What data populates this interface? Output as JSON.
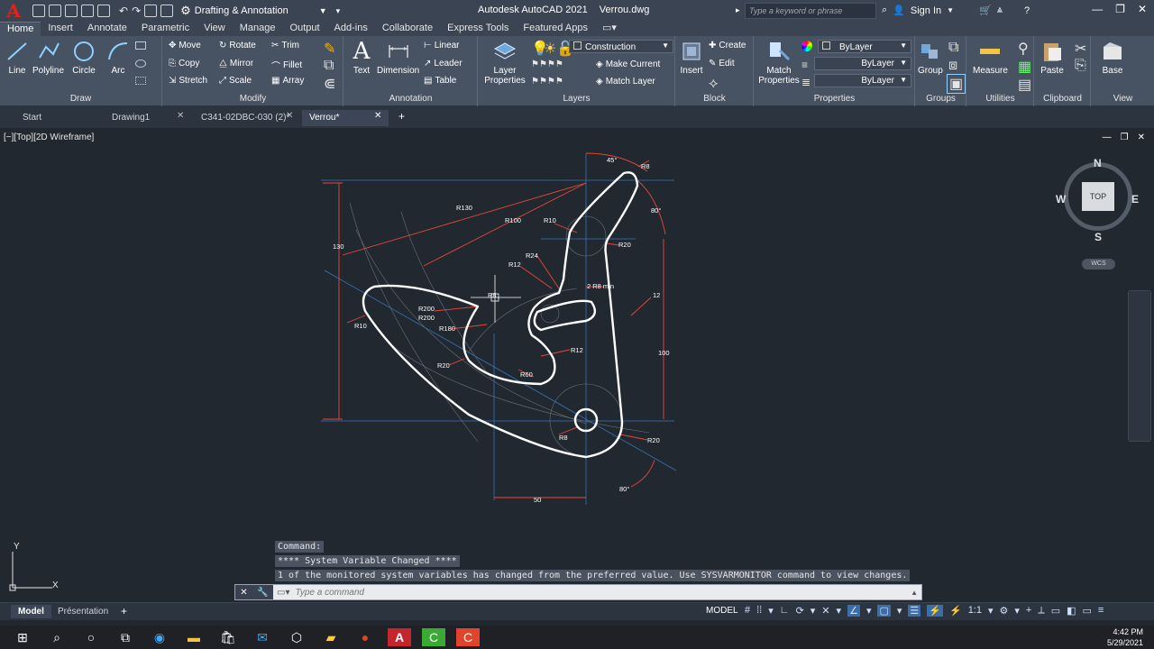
{
  "app": {
    "workspace": "Drafting & Annotation",
    "name": "Autodesk AutoCAD 2021",
    "file": "Verrou.dwg",
    "search_placeholder": "Type a keyword or phrase",
    "sign_in": "Sign In"
  },
  "menu_tabs": [
    "Home",
    "Insert",
    "Annotate",
    "Parametric",
    "View",
    "Manage",
    "Output",
    "Add-ins",
    "Collaborate",
    "Express Tools",
    "Featured Apps"
  ],
  "ribbon": {
    "draw": {
      "title": "Draw",
      "line": "Line",
      "polyline": "Polyline",
      "circle": "Circle",
      "arc": "Arc"
    },
    "modify": {
      "title": "Modify",
      "move": "Move",
      "rotate": "Rotate",
      "trim": "Trim",
      "copy": "Copy",
      "mirror": "Mirror",
      "fillet": "Fillet",
      "stretch": "Stretch",
      "scale": "Scale",
      "array": "Array"
    },
    "annotation": {
      "title": "Annotation",
      "text": "Text",
      "dimension": "Dimension",
      "linear": "Linear",
      "leader": "Leader",
      "table": "Table"
    },
    "layers": {
      "title": "Layers",
      "layer_properties": "Layer\nProperties",
      "current_layer": "Construction",
      "make_current": "Make Current",
      "match_layer": "Match Layer"
    },
    "block": {
      "title": "Block",
      "insert": "Insert",
      "create": "Create",
      "edit": "Edit"
    },
    "properties": {
      "title": "Properties",
      "match_properties": "Match\nProperties",
      "color": "ByLayer",
      "linetype": "ByLayer",
      "lineweight": "ByLayer"
    },
    "groups": {
      "title": "Groups",
      "group": "Group"
    },
    "utilities": {
      "title": "Utilities",
      "measure": "Measure"
    },
    "clipboard": {
      "title": "Clipboard",
      "paste": "Paste"
    },
    "view": {
      "title": "View",
      "base": "Base"
    }
  },
  "doc_tabs": [
    "Start",
    "Drawing1",
    "C341-02DBC-030 (2)*",
    "Verrou*"
  ],
  "viewport": {
    "label": "[−][Top][2D Wireframe]",
    "viewcube": {
      "n": "N",
      "s": "S",
      "e": "E",
      "w": "W",
      "face": "TOP",
      "wcs": "WCS"
    }
  },
  "dimensions": {
    "r130": "R130",
    "r100": "R100",
    "r10a": "R10",
    "r24": "R24",
    "r12a": "R12",
    "r8a": "R8",
    "r8b": "R8",
    "r20a": "R20",
    "two_r8": "2 R8 min",
    "r200a": "R200",
    "r200b": "R200",
    "r180": "R180",
    "r10b": "R10",
    "r20b": "R20",
    "r60": "R60",
    "r12b": "R12",
    "r8c": "R8",
    "r20c": "R20",
    "d130": "130",
    "d100": "100",
    "d12": "12",
    "d50": "50",
    "a45": "45°",
    "a80a": "80°",
    "a80b": "80°"
  },
  "command": {
    "line1": "Command:",
    "line2": "**** System Variable Changed ****",
    "line3": "1 of the monitored system variables has changed from the preferred value. Use SYSVARMONITOR command to view changes.",
    "placeholder": "Type a command"
  },
  "layout_tabs": [
    "Model",
    "Présentation"
  ],
  "status": {
    "model": "MODEL",
    "scale": "1:1"
  },
  "ucs": {
    "x": "X",
    "y": "Y"
  },
  "clock": {
    "time": "4:42 PM",
    "date": "5/29/2021"
  }
}
